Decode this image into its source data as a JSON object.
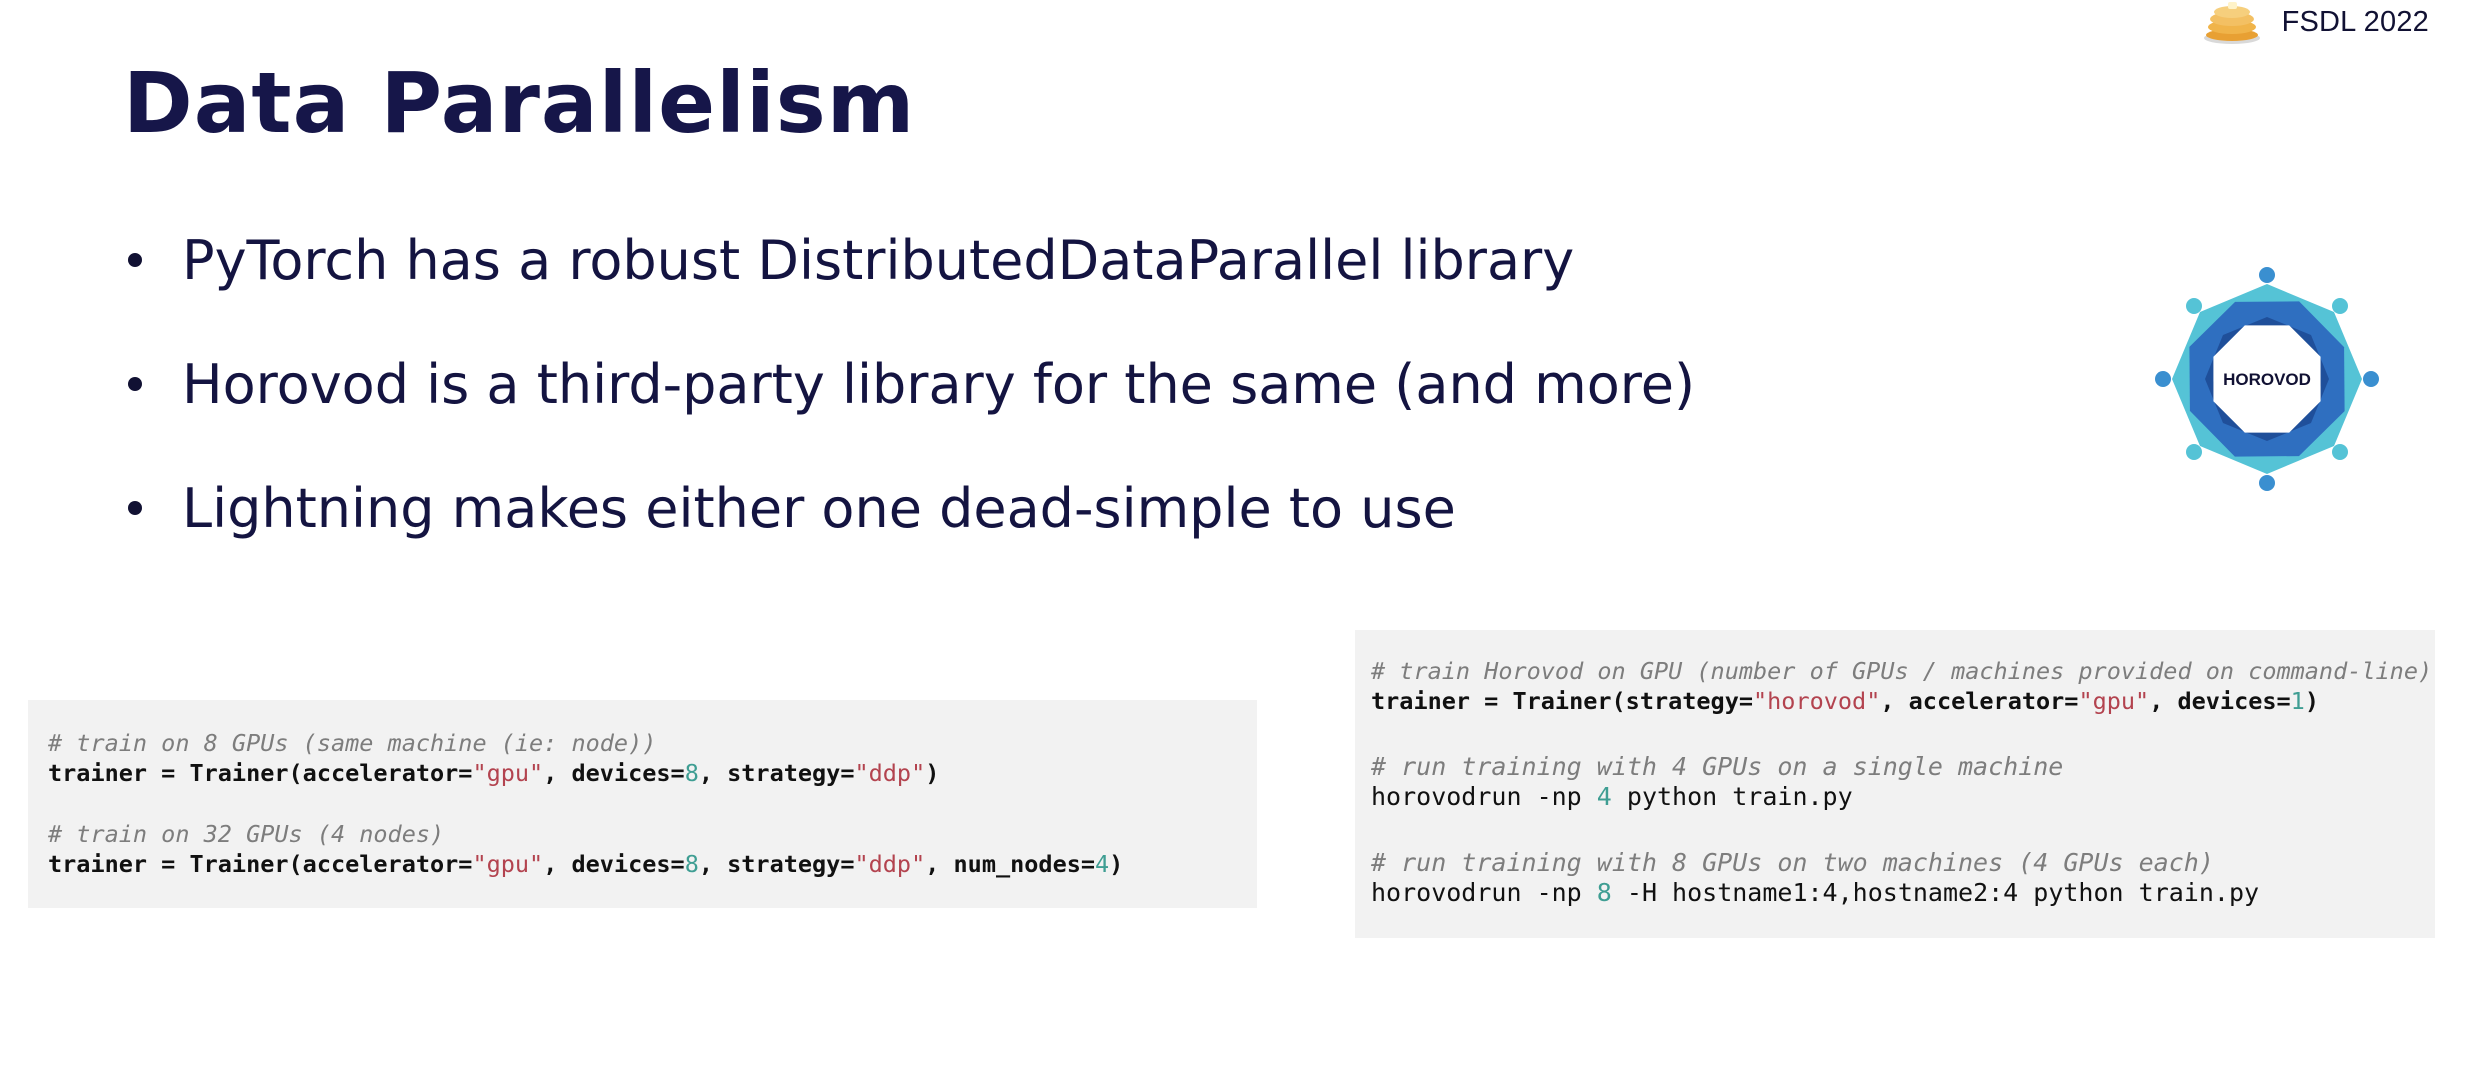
{
  "brand": {
    "text": "FSDL 2022",
    "logo_icon": "pancakes-icon"
  },
  "title": "Data Parallelism",
  "bullets": [
    "PyTorch has a robust DistributedDataParallel library",
    "Horovod is a third-party library for the same (and more)",
    "Lightning makes either one dead-simple to use"
  ],
  "horovod_logo": {
    "label": "HOROVOD"
  },
  "colors": {
    "title": "#161649",
    "code_bg": "#f2f2f2",
    "string": "#b3434f",
    "number": "#3f9e93",
    "comment": "#7d7d7d",
    "logo_dark_blue": "#2f6fc0",
    "logo_light_blue": "#55c3d6"
  },
  "code_left": {
    "comment1": "# train on 8 GPUs (same machine (ie: node))",
    "line1": {
      "a": "trainer = Trainer(accelerator=",
      "s1": "\"gpu\"",
      "b": ", devices=",
      "n1": "8",
      "c": ", strategy=",
      "s2": "\"ddp\"",
      "d": ")"
    },
    "comment2": "# train on 32 GPUs (4 nodes)",
    "line2": {
      "a": "trainer = Trainer(accelerator=",
      "s1": "\"gpu\"",
      "b": ", devices=",
      "n1": "8",
      "c": ", strategy=",
      "s2": "\"ddp\"",
      "d": ", num_nodes=",
      "n2": "4",
      "e": ")"
    }
  },
  "code_right": {
    "comment1": "# train Horovod on GPU (number of GPUs / machines provided on command-line)",
    "line1": {
      "a": "trainer = Trainer(strategy=",
      "s1": "\"horovod\"",
      "b": ", accelerator=",
      "s2": "\"gpu\"",
      "c": ", devices=",
      "n1": "1",
      "d": ")"
    },
    "comment2": "# run training with 4 GPUs on a single machine",
    "cmd1": {
      "a": "horovodrun -np ",
      "n1": "4",
      "b": " python train.py"
    },
    "comment3": "# run training with 8 GPUs on two machines (4 GPUs each)",
    "cmd2": {
      "a": "horovodrun -np ",
      "n1": "8",
      "b": " -H hostname1:4,hostname2:4 python train.py"
    }
  }
}
